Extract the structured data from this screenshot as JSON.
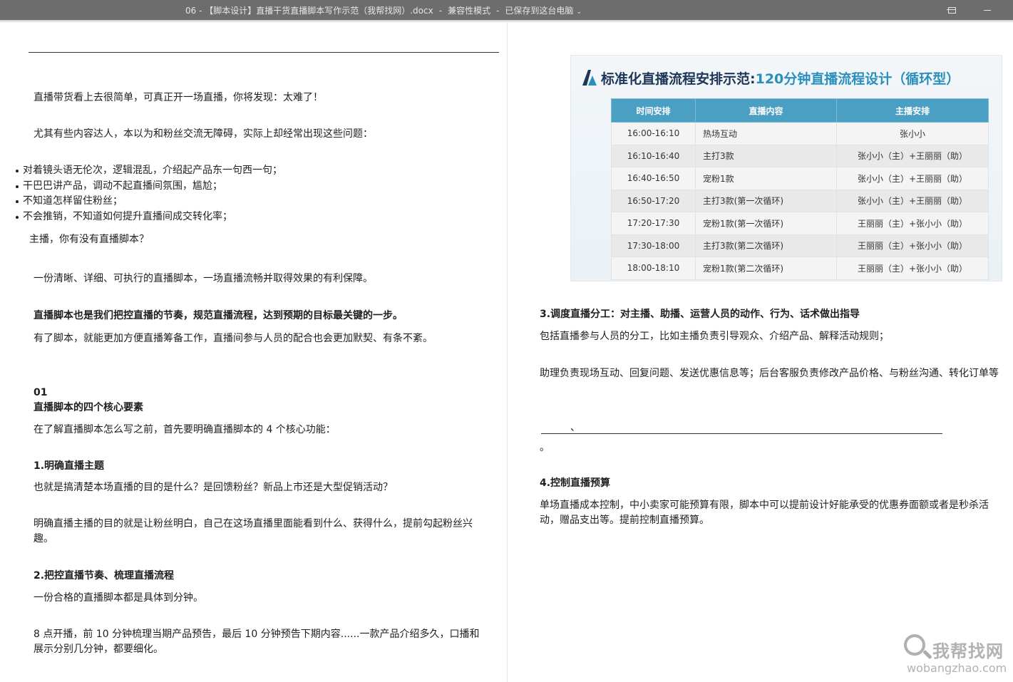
{
  "window": {
    "doc_name": "06 - 【脚本设计】直播干货直播脚本写作示范（我帮找网）.docx",
    "separator": "-",
    "mode": "兼容性模式",
    "save_status": "已保存到这台电脑",
    "status_caret": "⌄"
  },
  "left_page": {
    "p1": "直播带货看上去很简单，可真正开一场直播，你将发现：太难了！",
    "p2": "尤其有些内容达人，本以为和粉丝交流无障碍，实际上却经常出现这些问题：",
    "bullets": [
      "对着镜头语无伦次，逻辑混乱，介绍起产品东一句西一句；",
      "干巴巴讲产品，调动不起直播间氛围，尴尬；",
      "不知道怎样留住粉丝；",
      "不会推销，不知道如何提升直播间成交转化率；"
    ],
    "p3": "主播，你有没有直播脚本？",
    "p4": "一份清晰、详细、可执行的直播脚本，一场直播流畅并取得效果的有利保障。",
    "p5": "直播脚本也是我们把控直播的节奏，规范直播流程，达到预期的目标最关键的一步。",
    "p6": "有了脚本，就能更加方便直播筹备工作，直播间参与人员的配合也会更加默契、有条不紊。",
    "section_num": "01",
    "section_title": "直播脚本的四个核心要素",
    "p7": "在了解直播脚本怎么写之前，首先要明确直播脚本的  4 个核心功能：",
    "h1": "1.明确直播主题",
    "p8": "也就是搞清楚本场直播的目的是什么？是回馈粉丝？新品上市还是大型促销活动？",
    "p9": "明确直播主播的目的就是让粉丝明白，自己在这场直播里面能看到什么、获得什么，提前勾起粉丝兴趣。",
    "h2": "2.把控直播节奏、梳理直播流程",
    "p10": "一份合格的直播脚本都是具体到分钟。",
    "p11": "8 点开播，前 10 分钟梳理当期产品预告，最后  10 分钟预告下期内容......一款产品介绍多久，口播和展示分别几分钟，都要细化。"
  },
  "flow_image": {
    "title_lead": "标准化直播流程安排示范:",
    "title_accent": "120分钟直播流程设计（循环型）",
    "headers": [
      "时间安排",
      "直播内容",
      "主播安排"
    ],
    "rows": [
      [
        "16:00-16:10",
        "热场互动",
        "张小小"
      ],
      [
        "16:10-16:40",
        "主打3款",
        "张小小（主）+王丽丽（助）"
      ],
      [
        "16:40-16:50",
        "宠粉1款",
        "张小小（主）+王丽丽（助）"
      ],
      [
        "16:50-17:20",
        "主打3款(第一次循环)",
        "张小小（主）+王丽丽（助）"
      ],
      [
        "17:20-17:30",
        "宠粉1款(第一次循环)",
        "王丽丽（主）+张小小（助）"
      ],
      [
        "17:30-18:00",
        "主打3款(第二次循环)",
        "王丽丽（主）+张小小（助）"
      ],
      [
        "18:00-18:10",
        "宠粉1款(第二次循环)",
        "王丽丽（主）+张小小（助）"
      ]
    ]
  },
  "right_page": {
    "h3": "3.调度直播分工：对主播、助播、运营人员的动作、行为、话术做出指导",
    "p1": "包括直播参与人员的分工，比如主播负责引导观众、介绍产品、解释活动规则；",
    "p2": "助理负责现场互动、回复问题、发送优惠信息等；后台客服负责修改产品价格、与粉丝沟通、转化订单等",
    "fragment_comma": "、",
    "fragment_period": "。",
    "h4": "4.控制直播预算",
    "p3": "单场直播成本控制，中小卖家可能预算有限，脚本中可以提前设计好能承受的优惠券面额或者是秒杀活动，赠品支出等。提前控制直播预算。"
  },
  "watermark": {
    "cn": "我帮找网",
    "en": "wobangzhao.com"
  }
}
